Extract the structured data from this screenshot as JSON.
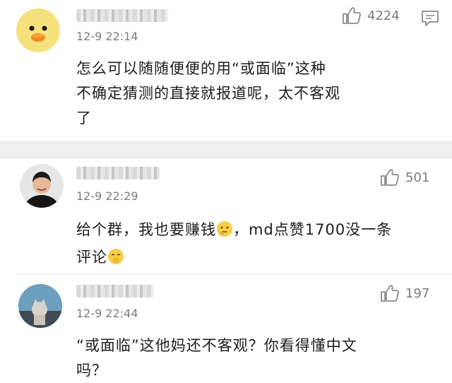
{
  "comments": [
    {
      "time": "12-9 22:14",
      "likes": "4224",
      "text_line1": "怎么可以随随便便的用“或面临”这种",
      "text_line2": "不确定猜测的直接就报道呢，太不客观",
      "text_line3": "了"
    },
    {
      "time": "12-9 22:29",
      "likes": "501",
      "text_a": "给个群，我也要赚钱",
      "text_b": "，md点赞1700没一条",
      "text_c": "评论"
    },
    {
      "time": "12-9 22:44",
      "likes": "197",
      "text_line1": "“或面临”这他妈还不客观？你看得懂中文",
      "text_line2": "吗？"
    }
  ],
  "icons": {
    "like": "thumbs-up-icon",
    "reply": "chat-bubble-icon",
    "emoji_1": "thinking-emoji",
    "emoji_2": "covering-mouth-emoji"
  },
  "colors": {
    "meta_text": "#7d7d7d",
    "divider": "#f0f0f0",
    "emoji_yellow": "#f6cf45"
  }
}
